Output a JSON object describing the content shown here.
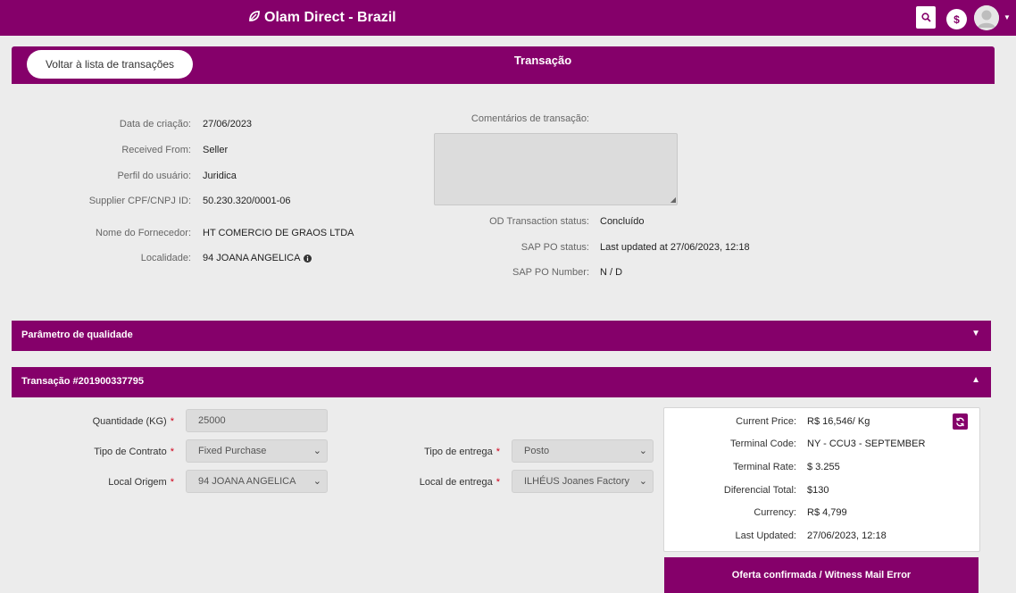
{
  "header": {
    "brand": "Olam Direct - Brazil",
    "currency_symbol": "$"
  },
  "card": {
    "back_label": "Voltar à lista de transações",
    "title": "Transação"
  },
  "details_left": [
    {
      "label": "Data de criação:",
      "value": "27/06/2023"
    },
    {
      "label": "Received From:",
      "value": "Seller"
    },
    {
      "label": "Perfil do usuário:",
      "value": "Juridica"
    },
    {
      "label": "Supplier CPF/CNPJ ID:",
      "value": "50.230.320/0001-06"
    },
    {
      "label": "Nome do Fornecedor:",
      "value": "HT COMERCIO DE GRAOS LTDA"
    },
    {
      "label": "Localidade:",
      "value": "94 JOANA ANGELICA"
    }
  ],
  "details_right": {
    "comments_label": "Comentários de transação:",
    "comments_value": "",
    "rows": [
      {
        "label": "OD Transaction status:",
        "value": "Concluído"
      },
      {
        "label": "SAP PO status:",
        "value": "Last updated at 27/06/2023, 12:18"
      },
      {
        "label": "SAP PO Number:",
        "value": "N / D"
      }
    ]
  },
  "sections": {
    "quality": {
      "title": "Parâmetro de qualidade",
      "arrow": "▼"
    },
    "transaction": {
      "title": "Transação #201900337795",
      "arrow": "▲"
    }
  },
  "form": {
    "quantity": {
      "label": "Quantidade (KG)",
      "value": "25000"
    },
    "contract_type": {
      "label": "Tipo de Contrato",
      "value": "Fixed Purchase"
    },
    "origin": {
      "label": "Local Origem",
      "value": "94 JOANA ANGELICA"
    },
    "delivery_type": {
      "label": "Tipo de entrega",
      "value": "Posto"
    },
    "delivery_location": {
      "label": "Local de entrega",
      "value": "ILHÉUS Joanes Factory"
    },
    "required_mark": "*"
  },
  "pricing": [
    {
      "label": "Current Price:",
      "value": "R$ 16,546/ Kg"
    },
    {
      "label": "Terminal Code:",
      "value": "NY - CCU3 - SEPTEMBER"
    },
    {
      "label": "Terminal Rate:",
      "value": "$ 3.255"
    },
    {
      "label": "Diferencial Total:",
      "value": "$130"
    },
    {
      "label": "Currency:",
      "value": "R$ 4,799"
    },
    {
      "label": "Last Updated:",
      "value": "27/06/2023, 12:18"
    }
  ],
  "status_bar": "Oferta confirmada / Witness Mail Error",
  "colors": {
    "brand": "#85006a",
    "panel_bg": "#ececec",
    "required": "#d0021b"
  }
}
